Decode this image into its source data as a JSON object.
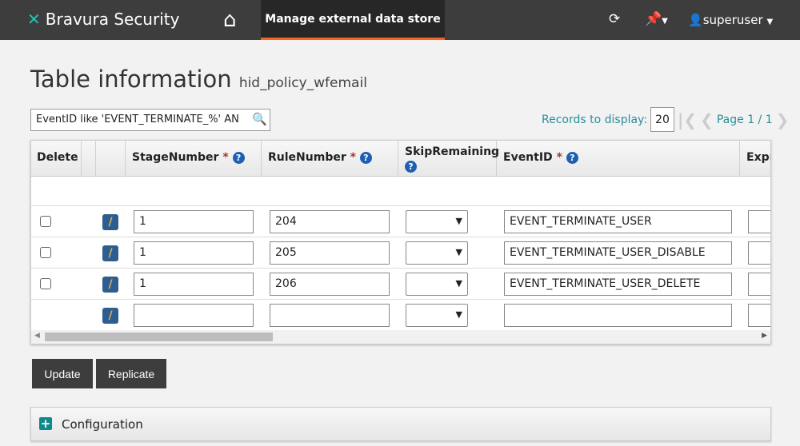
{
  "header": {
    "brand": "Bravura Security",
    "nav_tab": "Manage external data store",
    "user": "superuser",
    "icons": [
      "home-icon",
      "refresh-icon",
      "pin-icon",
      "user-icon"
    ]
  },
  "page": {
    "title": "Table information",
    "subtitle": "hid_policy_wfemail"
  },
  "filter": {
    "value": "EventID like 'EVENT_TERMINATE_%' AN"
  },
  "pagination": {
    "records_label": "Records to display:",
    "records_value": "20",
    "page_label": "Page 1 / 1"
  },
  "table": {
    "columns": [
      {
        "label": "Delete"
      },
      {
        "label": ""
      },
      {
        "label": ""
      },
      {
        "label": "StageNumber",
        "required": "*"
      },
      {
        "label": "RuleNumber",
        "required": "*"
      },
      {
        "label": "SkipRemaining"
      },
      {
        "label": "EventID",
        "required": "*"
      },
      {
        "label": "Expr"
      }
    ],
    "rows": [
      {
        "stage": "1",
        "rule": "204",
        "event": "EVENT_TERMINATE_USER"
      },
      {
        "stage": "1",
        "rule": "205",
        "event": "EVENT_TERMINATE_USER_DISABLE"
      },
      {
        "stage": "1",
        "rule": "206",
        "event": "EVENT_TERMINATE_USER_DELETE"
      },
      {
        "stage": "",
        "rule": "",
        "event": ""
      }
    ]
  },
  "buttons": {
    "update": "Update",
    "replicate": "Replicate"
  },
  "config": {
    "label": "Configuration"
  },
  "colors": {
    "accent": "#f26522",
    "teal": "#2a8f9a",
    "header_bg": "#3d3d3d"
  }
}
